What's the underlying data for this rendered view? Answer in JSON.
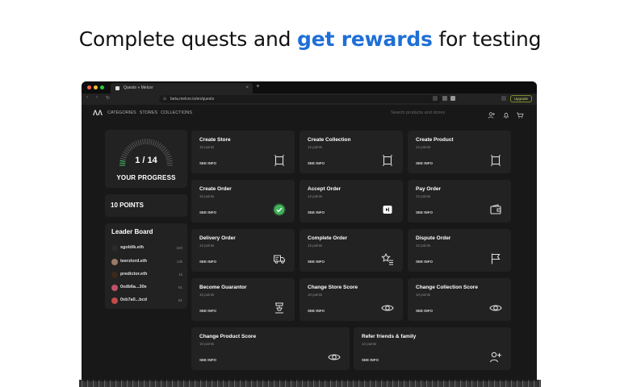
{
  "headline": {
    "part1": "Complete quests and ",
    "highlight": "get rewards",
    "part2": " for testing"
  },
  "browser": {
    "tab_title": "Quests ⋄ Melcer",
    "url": "beta.melcer.io/en/quests",
    "upgrade_label": "Upgrade"
  },
  "nav": {
    "logo": "ΛΛ",
    "links": [
      "CATEGORIES",
      "STORES",
      "COLLECTIONS"
    ],
    "search_placeholder": "Search products and stores"
  },
  "progress": {
    "count": "1 / 14",
    "label": "YOUR PROGRESS",
    "fraction": 0.07
  },
  "points": {
    "label": "10 POINTS"
  },
  "leaderboard": {
    "title": "Leader Board",
    "rows": [
      {
        "name": "sgoldik.eth",
        "score": "220",
        "color": "#2b2b2b"
      },
      {
        "name": "teerzlord.eth",
        "score": "13k",
        "color": "#9a7a66"
      },
      {
        "name": "predictor.eth",
        "score": "1k",
        "color": "#3a2a1a"
      },
      {
        "name": "0xdb6a...30e",
        "score": "81",
        "color": "#c0506a"
      },
      {
        "name": "0xb7a0...bcd",
        "score": "81",
        "color": "#c04a4a"
      }
    ]
  },
  "quests": [
    {
      "title": "Create Store",
      "points": "10 points",
      "info": "SEE INFO",
      "icon": "square-icon"
    },
    {
      "title": "Create Collection",
      "points": "12 points",
      "info": "SEE INFO",
      "icon": "square-icon"
    },
    {
      "title": "Create Product",
      "points": "12 points",
      "info": "SEE INFO",
      "icon": "square-icon"
    },
    {
      "title": "Create Order",
      "points": "10 points",
      "info": "SEE INFO",
      "icon": "check-icon"
    },
    {
      "title": "Accept Order",
      "points": "12 points",
      "info": "SEE INFO",
      "icon": "accept-icon"
    },
    {
      "title": "Pay Order",
      "points": "12 points",
      "info": "SEE INFO",
      "icon": "wallet-icon"
    },
    {
      "title": "Delivery Order",
      "points": "12 points",
      "info": "SEE INFO",
      "icon": "truck-icon"
    },
    {
      "title": "Complete Order",
      "points": "12 points",
      "info": "SEE INFO",
      "icon": "star-list-icon"
    },
    {
      "title": "Dispute Order",
      "points": "12 points",
      "info": "SEE INFO",
      "icon": "flag-icon"
    },
    {
      "title": "Become Guarantor",
      "points": "10 points",
      "info": "SEE INFO",
      "icon": "guarantor-icon"
    },
    {
      "title": "Change Store Score",
      "points": "10 points",
      "info": "SEE INFO",
      "icon": "eye-icon"
    },
    {
      "title": "Change Collection Score",
      "points": "10 points",
      "info": "SEE INFO",
      "icon": "eye-icon"
    },
    {
      "title": "Change Product Score",
      "points": "10 points",
      "info": "SEE INFO",
      "icon": "eye-icon"
    },
    {
      "title": "Refer friends & family",
      "points": "12 points",
      "info": "SEE INFO",
      "icon": "add-user-icon"
    }
  ]
}
